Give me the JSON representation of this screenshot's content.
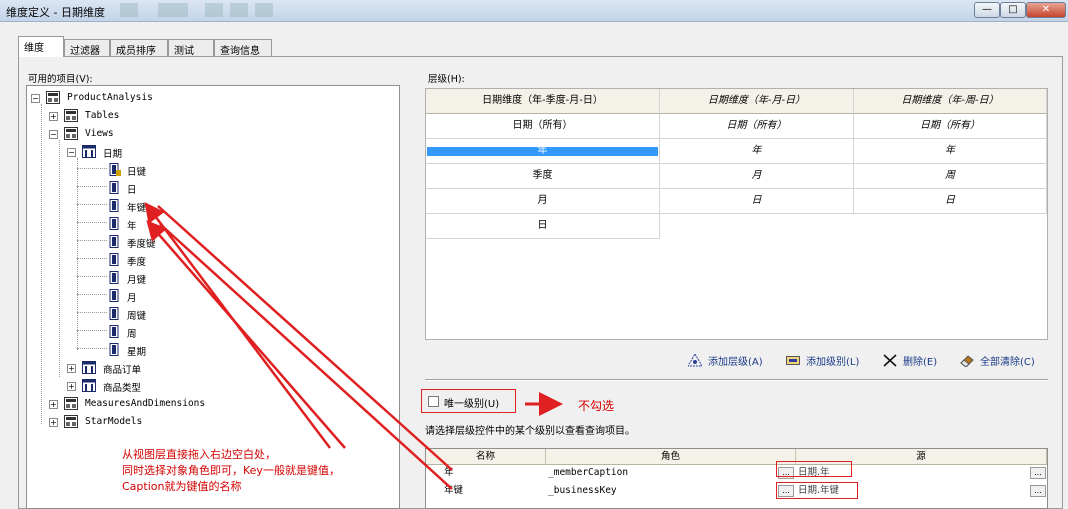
{
  "window": {
    "title": "维度定义 - 日期维度",
    "buttons": {
      "minimize": "—",
      "maximize": "□",
      "close": "✕"
    }
  },
  "tabs": [
    "维度",
    "过滤器",
    "成员排序",
    "测试",
    "查询信息"
  ],
  "left_panel": {
    "label": "可用的项目(V):",
    "tree": {
      "root": "ProductAnalysis",
      "tables": "Tables",
      "views": "Views",
      "date_view": "日期",
      "date_items": [
        "日键",
        "日",
        "年键",
        "年",
        "季度键",
        "季度",
        "月键",
        "月",
        "周键",
        "周",
        "星期"
      ],
      "other_views": [
        "商品订单",
        "商品类型"
      ],
      "measures": "MeasuresAndDimensions",
      "starmodels": "StarModels"
    }
  },
  "right_panel": {
    "hierarchy_label": "层级(H):",
    "grid": {
      "headers": [
        "日期维度（年-季度-月-日）",
        "日期维度（年-月-日）",
        "日期维度（年-周-日）"
      ],
      "col1": [
        "日期（所有）",
        "年",
        "季度",
        "月",
        "日"
      ],
      "col2": [
        "日期（所有）",
        "年",
        "月",
        "日"
      ],
      "col3": [
        "日期（所有）",
        "年",
        "周",
        "日"
      ],
      "selected_row": 1
    },
    "toolbar": {
      "add_hierarchy": "添加层级(A)",
      "add_level": "添加级别(L)",
      "delete": "删除(E)",
      "clear_all": "全部清除(C)"
    },
    "unique_level": {
      "label": "唯一级别(U)",
      "checked": false
    },
    "hint": "请选择层级控件中的某个级别以查看查询项目。",
    "table": {
      "headers": [
        "名称",
        "角色",
        "源"
      ],
      "rows": [
        {
          "name": "年",
          "role": "_memberCaption",
          "source": "日期.年"
        },
        {
          "name": "年键",
          "role": "_businessKey",
          "source": "日期.年键"
        }
      ],
      "ellipsis": "..."
    }
  },
  "annotations": {
    "not_checked": "不勾选",
    "drag_note": [
      "从视图层直接拖入右边空白处，",
      "同时选择对象角色即可，Key一般就是键值，",
      "Caption就为键值的名称"
    ]
  },
  "colors": {
    "annotation": "#d40000",
    "selection": "#3399ff",
    "link": "#1a3a8a",
    "header_bg": "#f4f1e8"
  }
}
